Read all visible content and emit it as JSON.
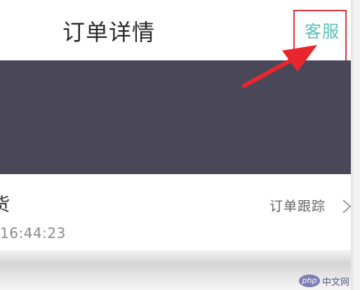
{
  "header": {
    "title": "订单详情",
    "service_label": "客服"
  },
  "order": {
    "status_fragment": "货",
    "time_fragment": "16:44:23",
    "track_label": "订单跟踪"
  },
  "icons": {
    "chevron": "chevron-right-icon",
    "arrow": "red-arrow-annotation"
  },
  "watermark": {
    "logo": "php",
    "text": "中文网"
  },
  "colors": {
    "service": "#5bc2b6",
    "banner": "#4a4858",
    "highlight": "#d9363e",
    "arrow": "#e8262d"
  }
}
